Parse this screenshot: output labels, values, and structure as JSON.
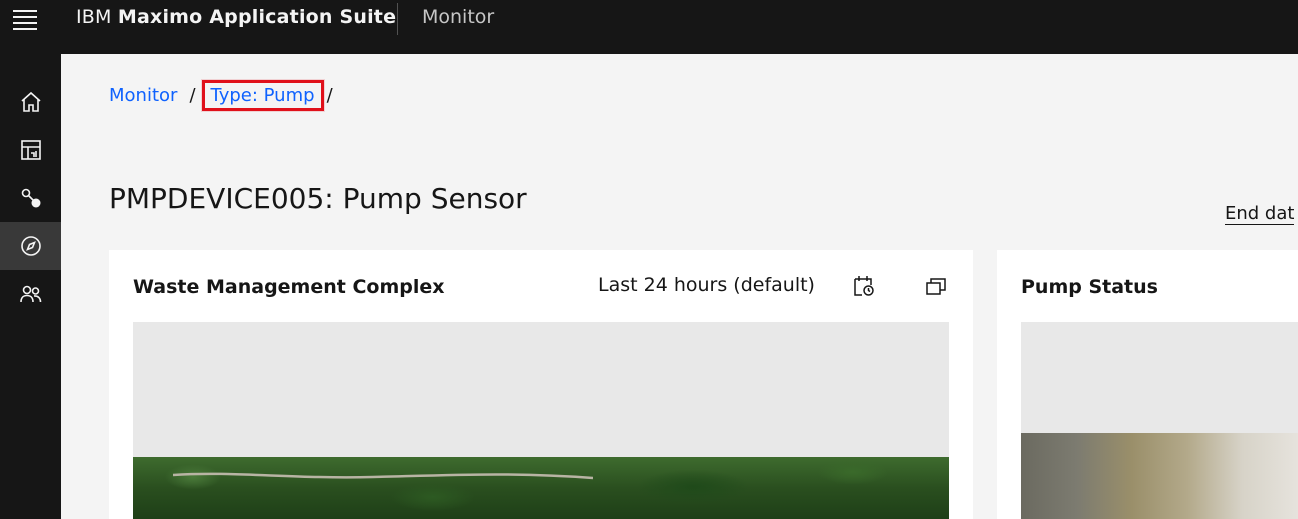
{
  "header": {
    "brand_ibm": "IBM",
    "brand_product": "Maximo Application Suite",
    "app_name": "Monitor"
  },
  "sidenav": {
    "items": [
      {
        "icon": "home-icon"
      },
      {
        "icon": "dashboard-icon"
      },
      {
        "icon": "connection-icon"
      },
      {
        "icon": "compass-icon",
        "active": true
      },
      {
        "icon": "user-multiple-icon"
      }
    ]
  },
  "breadcrumb": {
    "items": [
      {
        "label": "Monitor"
      },
      {
        "label": "Type: Pump"
      }
    ],
    "separator": "/"
  },
  "page": {
    "title": "PMPDEVICE005: Pump Sensor",
    "end_date_label": "End dat"
  },
  "cards": [
    {
      "title": "Waste Management Complex",
      "range": "Last 24 hours (default)"
    },
    {
      "title": "Pump Status"
    }
  ],
  "colors": {
    "header_bg": "#161616",
    "link": "#0f62fe",
    "highlight": "#e0101a"
  }
}
